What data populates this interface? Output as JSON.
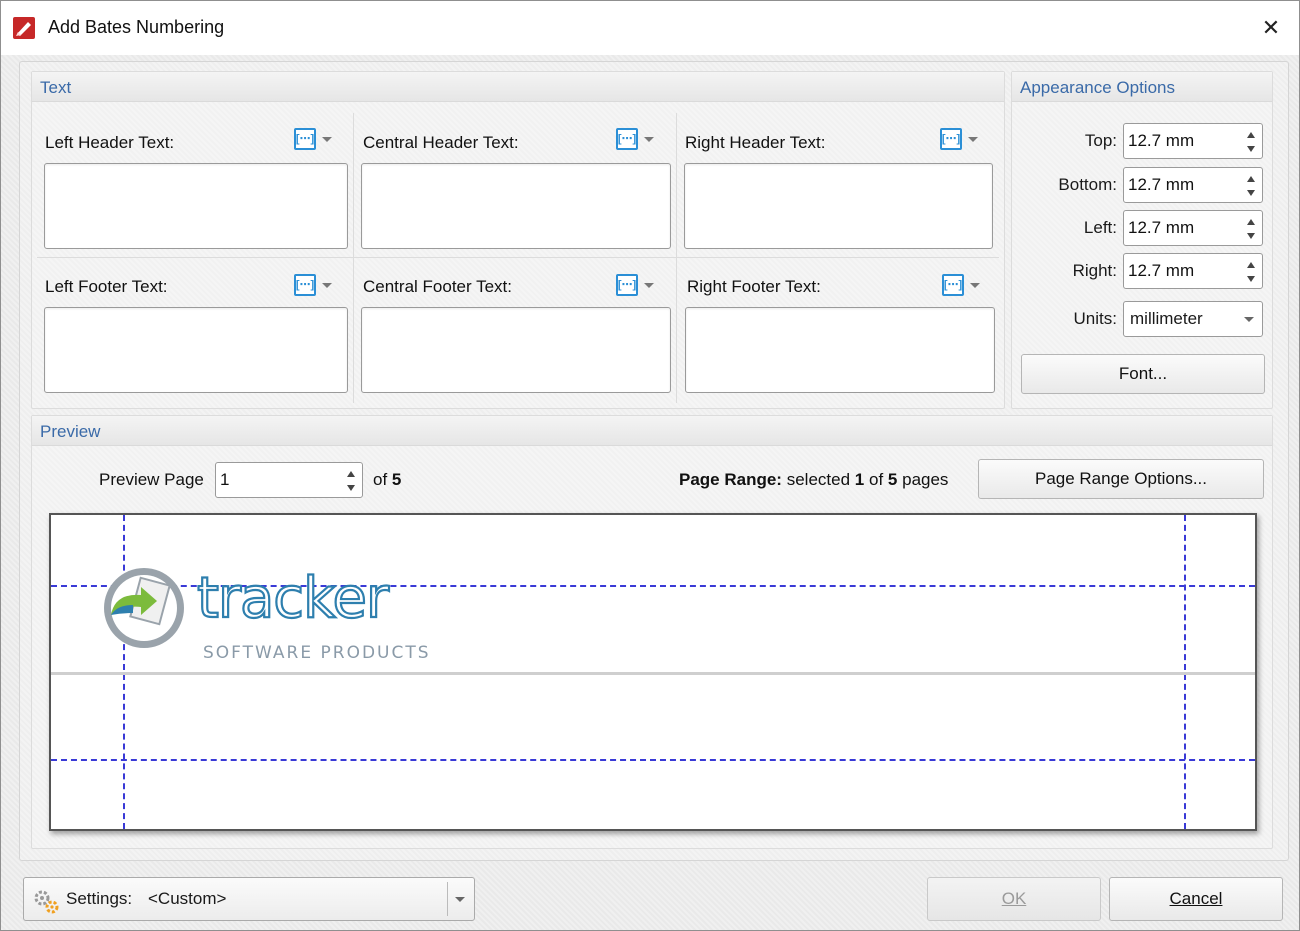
{
  "window": {
    "title": "Add Bates Numbering",
    "close_glyph": "✕"
  },
  "text_group": {
    "title": "Text",
    "fields": [
      {
        "label": "Left Header Text:",
        "value": ""
      },
      {
        "label": "Central Header Text:",
        "value": ""
      },
      {
        "label": "Right Header Text:",
        "value": ""
      },
      {
        "label": "Left Footer Text:",
        "value": ""
      },
      {
        "label": "Central Footer Text:",
        "value": ""
      },
      {
        "label": "Right Footer Text:",
        "value": ""
      }
    ],
    "macro_glyph": "[···]"
  },
  "appearance": {
    "title": "Appearance Options",
    "top_label": "Top:",
    "top_value": "12.7 mm",
    "bottom_label": "Bottom:",
    "bottom_value": "12.7 mm",
    "left_label": "Left:",
    "left_value": "12.7 mm",
    "right_label": "Right:",
    "right_value": "12.7 mm",
    "units_label": "Units:",
    "units_value": "millimeter",
    "font_button": "Font..."
  },
  "preview": {
    "title": "Preview",
    "page_label": "Preview Page",
    "page_value": "1",
    "of_text": "of",
    "total_pages": "5",
    "range_label": "Page Range:",
    "range_text_1": "selected",
    "range_selected": "1",
    "range_text_2": "of",
    "range_total": "5",
    "range_text_3": "pages",
    "range_button": "Page Range Options...",
    "logo_word": "tracker",
    "logo_tagline": "SOFTWARE PRODUCTS"
  },
  "footer": {
    "settings_label": "Settings:",
    "settings_value": "<Custom>",
    "ok_label": "OK",
    "cancel_label": "Cancel"
  },
  "colors": {
    "group_title": "#3a6aa8",
    "guide_line": "#3a3ad6",
    "macro_icon": "#2b8fd6",
    "logo_blue": "#2e7fae"
  },
  "icons": [
    "app-icon",
    "close-icon",
    "macro-icon",
    "spin-up-icon",
    "spin-down-icon",
    "dropdown-caret-icon",
    "settings-gear-icon",
    "tracker-logo-icon"
  ]
}
